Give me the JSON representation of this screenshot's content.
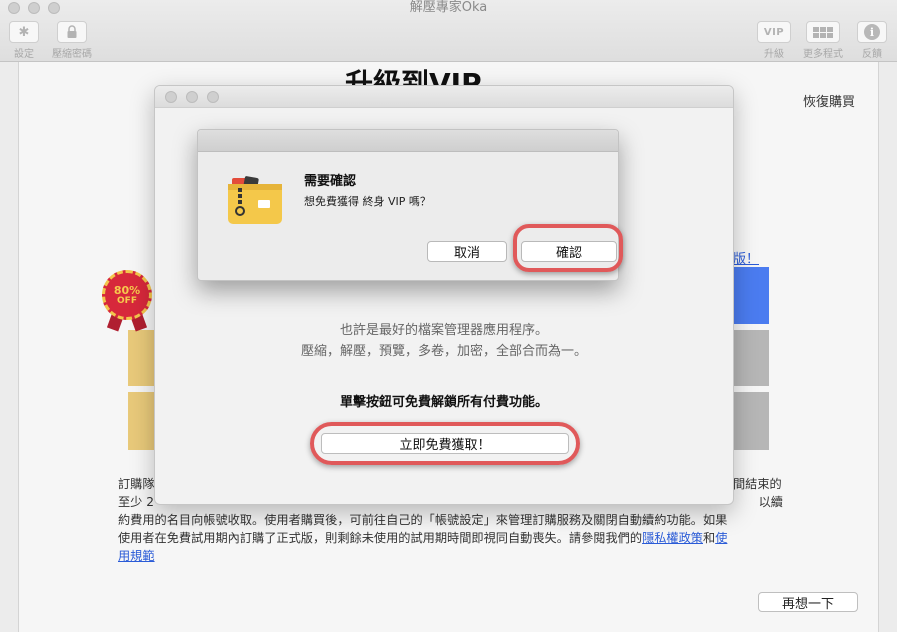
{
  "window": {
    "title": "解壓專家Oka"
  },
  "toolbar": {
    "settings_label": "設定",
    "compress_password_label": "壓縮密碼",
    "vip_badge": "VIP",
    "upgrade_label": "升級",
    "more_apps_label": "更多程式",
    "feedback_label": "反饋"
  },
  "vip_page": {
    "title": "升級到VIP",
    "restore_purchase": "恢復購買",
    "upgrade_link": "版！",
    "badge_percent": "80%",
    "badge_off": "OFF",
    "terms_line1": "訂購隊",
    "terms_line2": "至少 2",
    "terms_right1": "間結束的",
    "terms_right2": "以續",
    "terms_line3": "約費用的名目向帳號收取。使用者購買後，可前往自己的「帳號設定」來管理訂購服務及關閉自動續約功能。如果",
    "terms_line4_a": "使用者在免費試用期內訂購了正式版，則剩餘未使用的試用期時間即視同自動喪失。請參閱我們的",
    "privacy_link": "隱私權政策",
    "and_text": "和",
    "terms_link_a": "使",
    "terms_link_b": "用規範",
    "rethink_button": "再想一下"
  },
  "modal": {
    "desc_line1": "也許是最好的檔案管理器應用程序。",
    "desc_line2": "壓縮，解壓，預覽，多卷，加密，全部合而為一。",
    "unlock_text": "單擊按鈕可免費解鎖所有付費功能。",
    "free_button": "立即免費獲取！"
  },
  "alert": {
    "title": "需要確認",
    "message": "想免費獲得 終身 VIP 嗎？",
    "cancel_button": "取消",
    "confirm_button": "確認"
  },
  "colors": {
    "accent_blue": "#4b7cf0",
    "highlight_red": "#e0595a",
    "folder_yellow": "#f4c84a"
  }
}
